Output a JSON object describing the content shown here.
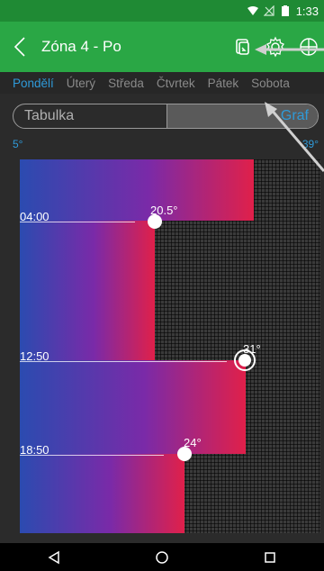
{
  "status_bar": {
    "time": "1:33",
    "icons": [
      "wifi-icon",
      "signal-off-icon",
      "battery-icon"
    ]
  },
  "app_bar": {
    "title": "Zóna 4 - Po",
    "icons": [
      "back-icon",
      "copy-icon",
      "gear-icon",
      "thermometer-icon"
    ]
  },
  "days": [
    {
      "label": "Pondělí",
      "active": true
    },
    {
      "label": "Úterý",
      "active": false
    },
    {
      "label": "Středa",
      "active": false
    },
    {
      "label": "Čtvrtek",
      "active": false
    },
    {
      "label": "Pátek",
      "active": false
    },
    {
      "label": "Sobota",
      "active": false
    }
  ],
  "view_toggle": {
    "left": "Tabulka",
    "right": "Graf",
    "selected": "Graf"
  },
  "range": {
    "min": "5°",
    "max": "39°"
  },
  "schedule": [
    {
      "time": "04:00",
      "temp": "20.5°",
      "value": 20.5
    },
    {
      "time": "12:50",
      "temp": "31°",
      "value": 31
    },
    {
      "time": "18:50",
      "temp": "24°",
      "value": 24
    }
  ],
  "colors": {
    "statusbar": "#1f8a34",
    "appbar": "#2aa745",
    "accent": "#2f9ad8",
    "gradient_start": "#2b4bb0",
    "gradient_end": "#e0204a"
  },
  "nav": {
    "icons": [
      "back-triangle-icon",
      "home-circle-icon",
      "recents-square-icon"
    ]
  }
}
